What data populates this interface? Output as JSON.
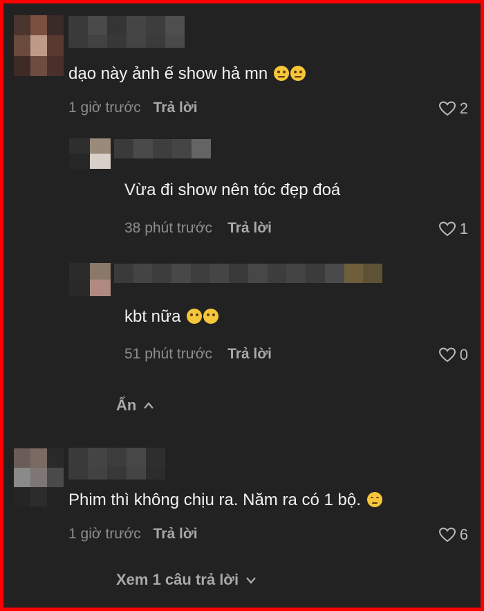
{
  "colors": {
    "background": "#222222",
    "border": "#ff0000",
    "primary_text": "#f2f2f2",
    "secondary_text": "#8d8d8d",
    "reply_link": "#a9a9a9"
  },
  "comments": [
    {
      "text": "dạo này ảnh ế show hả mn",
      "emoji": "🤨🤨",
      "time": "1 giờ trước",
      "reply_label": "Trả lời",
      "likes": "2"
    },
    {
      "text": "Vừa đi show nên tóc đẹp đoá",
      "time": "38 phút trước",
      "reply_label": "Trả lời",
      "likes": "1"
    },
    {
      "text": "kbt nữa",
      "emoji": "🤭🤭",
      "time": "51 phút trước",
      "reply_label": "Trả lời",
      "likes": "0"
    },
    {
      "text": "Phim thì không chịu ra. Năm ra có 1 bộ.",
      "emoji": "😌",
      "time": "1 giờ trước",
      "reply_label": "Trả lời",
      "likes": "6"
    }
  ],
  "hide_replies_label": "Ẩn",
  "view_replies_label": "Xem 1 câu trả lời",
  "icons": [
    "heart-icon",
    "chevron-up-icon",
    "chevron-down-icon"
  ]
}
